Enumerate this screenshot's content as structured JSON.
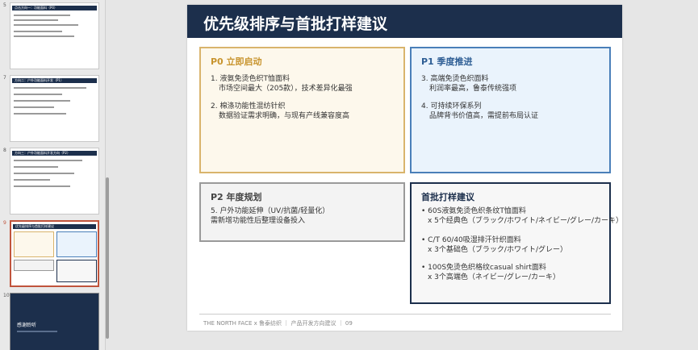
{
  "thumbnails": [
    {
      "num": "5",
      "title": "点击方向一：功能面料（P0）"
    },
    {
      "num": "7",
      "title": "方向二：户外功能面料开发（P1）"
    },
    {
      "num": "8",
      "title": "方向三：户外功能面料开发方向（P2）"
    },
    {
      "num": "9",
      "title": "优先级排序与首批打样建议"
    },
    {
      "num": "10",
      "title": "感谢聆听"
    }
  ],
  "slide": {
    "title": "优先级排序与首批打样建议",
    "p0": {
      "title": "P0 立即启动",
      "items": [
        "1. 液氨免烫色织T恤面料",
        "市场空间最大（205款），技术差异化最强",
        "2. 棉涤功能性混纺针织",
        "数据验证需求明确，与现有产线兼容度高"
      ]
    },
    "p1": {
      "title": "P1 季度推进",
      "items": [
        "3. 高端免烫色织面料",
        "利润率最高，鲁泰传统强项",
        "4. 可持续环保系列",
        "品牌背书价值高，需提前布局认证"
      ]
    },
    "p2": {
      "title": "P2 年度规划",
      "items": [
        "5. 户外功能延伸（UV/抗菌/轻量化）",
        "需新增功能性后整理设备投入"
      ]
    },
    "batch": {
      "title": "首批打样建议",
      "items": [
        "• 60S液氨免烫色织条纹T恤面料",
        "x 5个经典色（ブラック/ホワイト/ネイビー/グレー/カーキ）",
        "• C/T 60/40吸湿排汗针织面料",
        "x 3个基础色（ブラック/ホワイト/グレー）",
        "• 100S免烫色织格纹casual shirt面料",
        "x 3个高端色（ネイビー/グレー/カーキ）"
      ]
    },
    "footer": "THE NORTH FACE x 鲁泰纺织 ｜ 产品开发方向建议 ｜ 09"
  },
  "colors": {
    "navy": "#1c2f4c",
    "p0_accent": "#d9b46c",
    "p1_accent": "#4a7fb9",
    "p2_accent": "#9a9a9a"
  }
}
